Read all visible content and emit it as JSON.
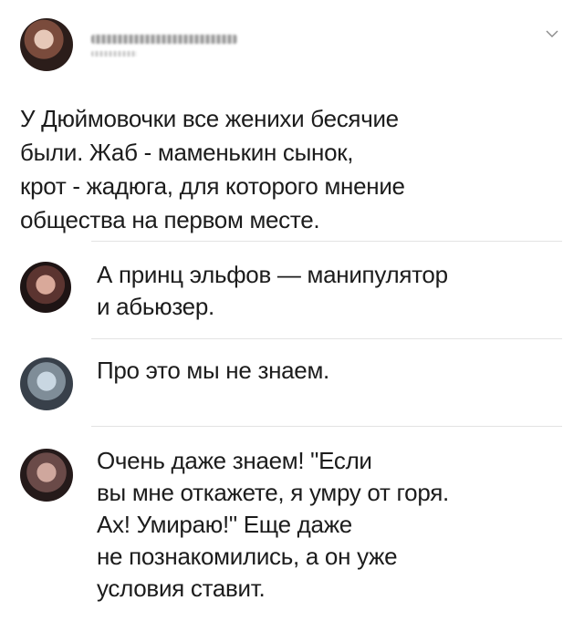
{
  "post": {
    "author_name": "",
    "author_handle": "",
    "text": "У Дюймовочки все женихи бесячие\nбыли. Жаб - маменькин сынок,\nкрот - жадюга, для которого мнение\nобщества на первом месте."
  },
  "icons": {
    "menu": "chevron-down-icon"
  },
  "replies": [
    {
      "text": "А принц эльфов — манипулятор\nи абьюзер."
    },
    {
      "text": "Про это мы не знаем."
    },
    {
      "text": "Очень даже знаем! \"Если\nвы мне откажете, я умру от горя.\nАх! Умираю!\" Еще даже\nне познакомились, а он уже\nусловия ставит."
    }
  ],
  "colors": {
    "text": "#1c1c1c",
    "divider": "#e3e3e3",
    "icon": "#8a8a8a"
  }
}
